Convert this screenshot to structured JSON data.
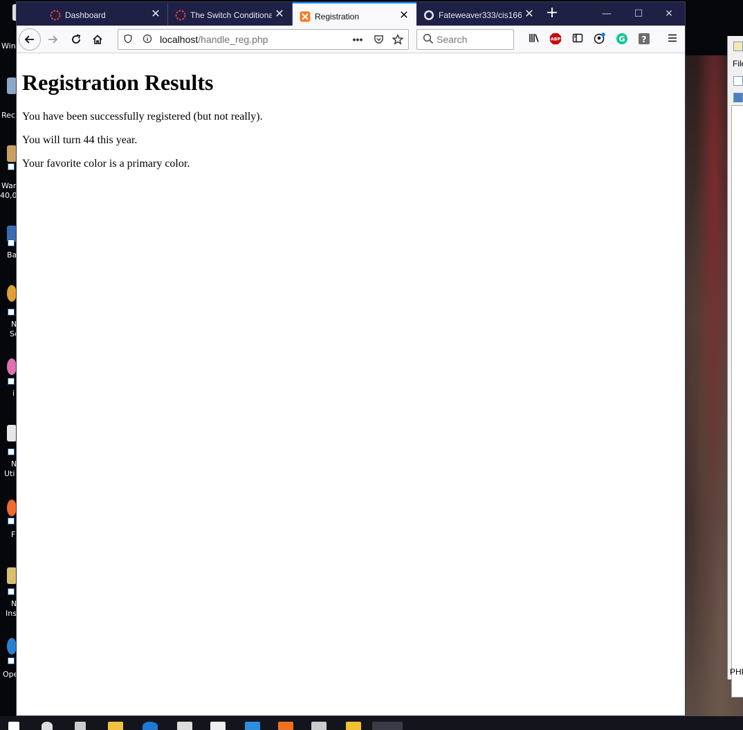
{
  "browser": {
    "tabs": [
      {
        "title": "Dashboard",
        "active": false,
        "favicon": "tool-icon"
      },
      {
        "title": "The Switch Conditional",
        "active": false,
        "favicon": "tool-icon"
      },
      {
        "title": "Registration",
        "active": true,
        "favicon": "xampp-icon"
      },
      {
        "title": "Fateweaver333/cis166",
        "active": false,
        "favicon": "github-icon"
      }
    ],
    "url": {
      "host": "localhost",
      "path": "/handle_reg.php"
    },
    "search_placeholder": "Search"
  },
  "page": {
    "heading": "Registration Results",
    "messages": [
      "You have been successfully registered (but not really).",
      "You will turn 44 this year.",
      "Your favorite color is a primary color."
    ]
  },
  "desktop": {
    "icons": [
      {
        "label": "Win"
      },
      {
        "label": "Rec"
      },
      {
        "label": "War"
      },
      {
        "label": "40,0"
      },
      {
        "label": "Ba"
      },
      {
        "label": "N"
      },
      {
        "label": "Sc"
      },
      {
        "label": "i"
      },
      {
        "label": "N"
      },
      {
        "label": "Uti"
      },
      {
        "label": "F"
      },
      {
        "label": "N"
      },
      {
        "label": "Ins"
      },
      {
        "label": "Ope"
      }
    ],
    "side_app": {
      "menu": "File",
      "status": "PHP"
    }
  },
  "colors": {
    "titlebar": "#1f2046",
    "accent": "#0a84ff",
    "abp": "#c70d0c",
    "grammarly": "#15c39a"
  }
}
